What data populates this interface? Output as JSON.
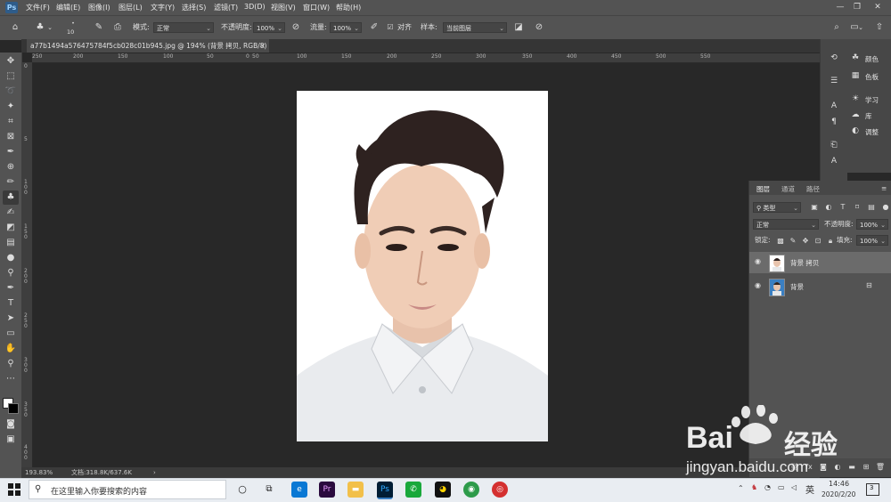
{
  "menubar": {
    "logo": "Ps",
    "items": [
      "文件(F)",
      "编辑(E)",
      "图像(I)",
      "图层(L)",
      "文字(Y)",
      "选择(S)",
      "滤镜(T)",
      "3D(D)",
      "视图(V)",
      "窗口(W)",
      "帮助(H)"
    ],
    "window_controls": [
      "—",
      "❐",
      "✕"
    ]
  },
  "options": {
    "brush_size": "10",
    "mode_label": "模式:",
    "mode_value": "正常",
    "opacity_label": "不透明度:",
    "opacity_value": "100%",
    "flow_label": "流量:",
    "flow_value": "100%",
    "align_label": "对齐",
    "sample_label": "样本:",
    "sample_value": "当前图层"
  },
  "document_tab": {
    "title": "a77b1494a576475784f5cb028c01b945.jpg @ 194% (背景 拷贝, RGB/8) *",
    "close": "×"
  },
  "ruler_h": [
    "250",
    "200",
    "150",
    "100",
    "50",
    "0",
    "50",
    "100",
    "150",
    "200",
    "250",
    "300",
    "350",
    "400",
    "450",
    "500",
    "550"
  ],
  "ruler_v": [
    "0",
    "5",
    "1\n0\n0",
    "1\n5\n0",
    "2\n0\n0",
    "2\n5\n0",
    "3\n0\n0",
    "3\n5\n0",
    "4\n0\n0"
  ],
  "status": {
    "zoom": "193.83%",
    "doc_info": "文档:318.8K/637.6K",
    "arrow": "›"
  },
  "right_panels": [
    {
      "icon": "palette-icon",
      "label": "颜色"
    },
    {
      "icon": "grid-icon",
      "label": "色板"
    },
    {
      "icon": "lightbulb-icon",
      "label": "学习"
    },
    {
      "icon": "library-icon",
      "label": "库"
    },
    {
      "icon": "adjust-icon",
      "label": "调整"
    }
  ],
  "layers_panel": {
    "tabs": [
      "图层",
      "通道",
      "路径"
    ],
    "filter_label": "类型",
    "blend_mode": "正常",
    "opacity_label": "不透明度:",
    "opacity_value": "100%",
    "lock_label": "锁定:",
    "fill_label": "填充:",
    "fill_value": "100%",
    "layers": [
      {
        "name": "背景 拷贝",
        "selected": true
      },
      {
        "name": "背景",
        "selected": false
      }
    ]
  },
  "taskbar": {
    "search_placeholder": "在这里输入你要搜索的内容",
    "ime": "英",
    "time": "14:46",
    "date": "2020/2/20",
    "notification_count": "3"
  },
  "watermark": {
    "brand": "Bai",
    "brand2": "经验",
    "url": "jingyan.baidu.com"
  },
  "colors": {
    "ps_bg": "#282828",
    "panel": "#535353",
    "accent_ps": "#31a8ff"
  }
}
